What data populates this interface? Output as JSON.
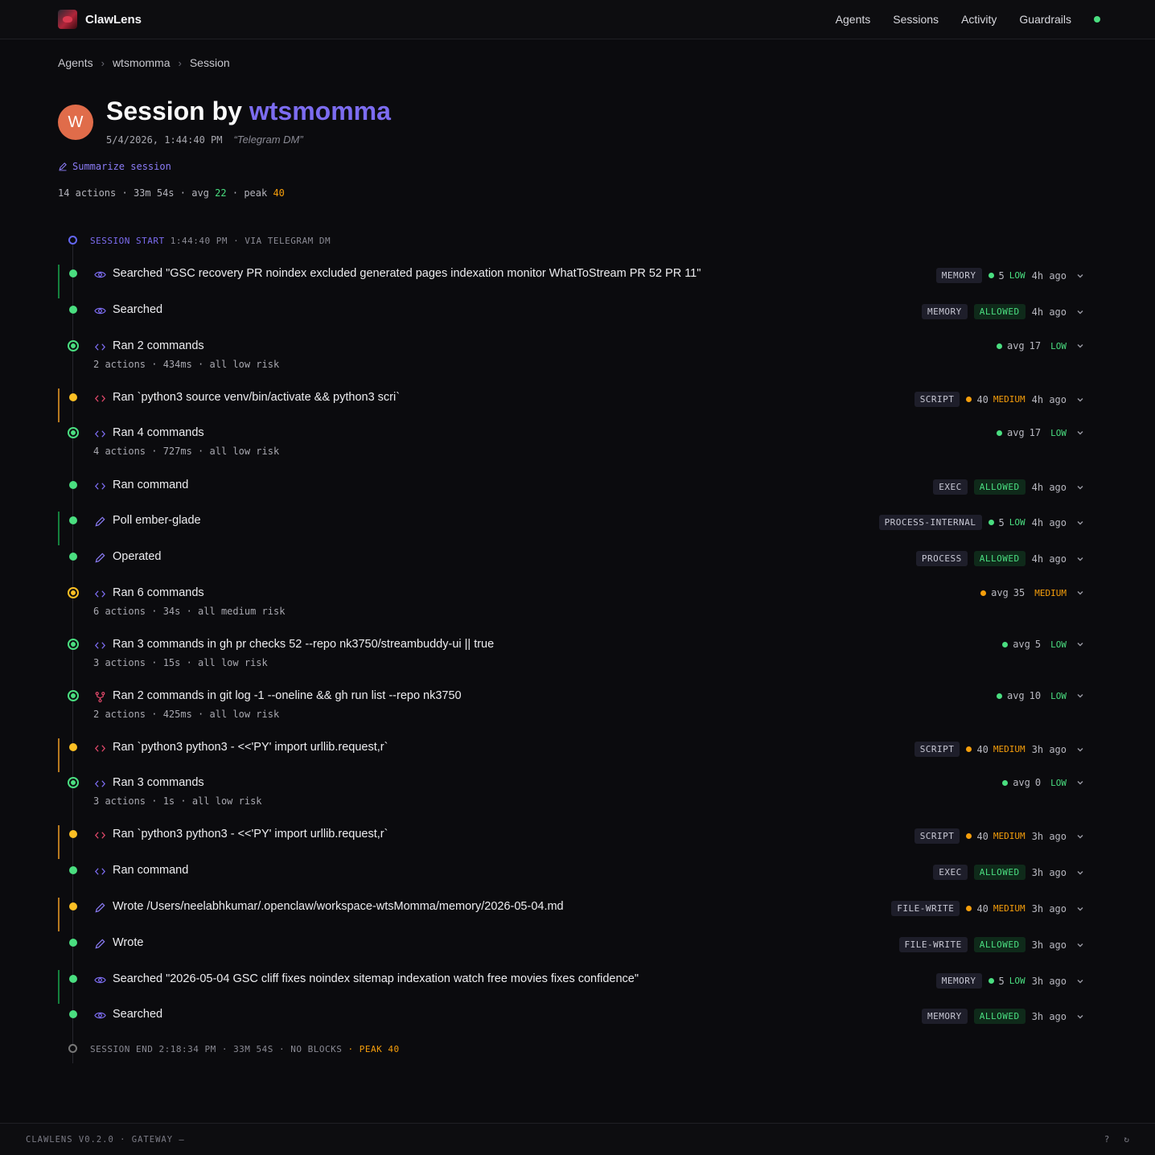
{
  "app": {
    "name": "ClawLens"
  },
  "nav": {
    "agents": "Agents",
    "sessions": "Sessions",
    "activity": "Activity",
    "guardrails": "Guardrails"
  },
  "breadcrumb": [
    "Agents",
    "wtsmomma",
    "Session"
  ],
  "header": {
    "avatar_letter": "W",
    "title_prefix": "Session by",
    "username": "wtsmomma",
    "timestamp": "5/4/2026, 1:44:40 PM",
    "channel_quote": "“Telegram DM”",
    "summarize_label": "Summarize session"
  },
  "stats": {
    "actions": "14 actions",
    "duration": "33m 54s",
    "avg_label": "avg",
    "avg": "22",
    "peak_label": "peak",
    "peak": "40",
    "sep": "·"
  },
  "timeline": {
    "start": {
      "label": "SESSION START",
      "rest": "1:44:40 PM · VIA TELEGRAM DM"
    },
    "end": {
      "label": "SESSION END 2:18:34 PM · 33M 54S · NO BLOCKS",
      "peak": "· PEAK 40"
    },
    "rows": [
      {
        "title": "Searched \"GSC recovery PR noindex excluded generated pages indexation monitor WhatToStream PR 52 PR 11\"",
        "tag": "MEMORY",
        "score": "5",
        "level": "LOW",
        "ago": "4h ago"
      },
      {
        "title": "Searched",
        "tag": "MEMORY",
        "status": "ALLOWED",
        "ago": "4h ago"
      },
      {
        "title": "Ran 2 commands",
        "sub": "2 actions · 434ms · all low risk",
        "avg_label": "avg",
        "avg": "17",
        "level": "LOW"
      },
      {
        "title": "Ran `python3 source venv/bin/activate && python3 scri`",
        "tag": "SCRIPT",
        "score": "40",
        "level": "MEDIUM",
        "ago": "4h ago"
      },
      {
        "title": "Ran 4 commands",
        "sub": "4 actions · 727ms · all low risk",
        "avg_label": "avg",
        "avg": "17",
        "level": "LOW"
      },
      {
        "title": "Ran command",
        "tag": "EXEC",
        "status": "ALLOWED",
        "ago": "4h ago"
      },
      {
        "title": "Poll ember-glade",
        "tag": "PROCESS-INTERNAL",
        "score": "5",
        "level": "LOW",
        "ago": "4h ago"
      },
      {
        "title": "Operated",
        "tag": "PROCESS",
        "status": "ALLOWED",
        "ago": "4h ago"
      },
      {
        "title": "Ran 6 commands",
        "sub": "6 actions · 34s · all medium risk",
        "avg_label": "avg",
        "avg": "35",
        "level": "MEDIUM"
      },
      {
        "title": "Ran 3 commands in gh pr checks 52 --repo nk3750/streambuddy-ui || true",
        "sub": "3 actions · 15s · all low risk",
        "avg_label": "avg",
        "avg": "5",
        "level": "LOW"
      },
      {
        "title": "Ran 2 commands in git log -1 --oneline && gh run list --repo nk3750",
        "sub": "2 actions · 425ms · all low risk",
        "avg_label": "avg",
        "avg": "10",
        "level": "LOW"
      },
      {
        "title": "Ran `python3 python3 - <<'PY' import urllib.request,r`",
        "tag": "SCRIPT",
        "score": "40",
        "level": "MEDIUM",
        "ago": "3h ago"
      },
      {
        "title": "Ran 3 commands",
        "sub": "3 actions · 1s · all low risk",
        "avg_label": "avg",
        "avg": "0",
        "level": "LOW"
      },
      {
        "title": "Ran `python3 python3 - <<'PY' import urllib.request,r`",
        "tag": "SCRIPT",
        "score": "40",
        "level": "MEDIUM",
        "ago": "3h ago"
      },
      {
        "title": "Ran command",
        "tag": "EXEC",
        "status": "ALLOWED",
        "ago": "3h ago"
      },
      {
        "title": "Wrote /Users/neelabhkumar/.openclaw/workspace-wtsMomma/memory/2026-05-04.md",
        "tag": "FILE-WRITE",
        "score": "40",
        "level": "MEDIUM",
        "ago": "3h ago"
      },
      {
        "title": "Wrote",
        "tag": "FILE-WRITE",
        "status": "ALLOWED",
        "ago": "3h ago"
      },
      {
        "title": "Searched \"2026-05-04 GSC cliff fixes noindex sitemap indexation watch free movies fixes confidence\"",
        "tag": "MEMORY",
        "score": "5",
        "level": "LOW",
        "ago": "3h ago"
      },
      {
        "title": "Searched",
        "tag": "MEMORY",
        "status": "ALLOWED",
        "ago": "3h ago"
      }
    ]
  },
  "footer": {
    "text": "CLAWLENS V0.2.0 · GATEWAY —",
    "help": "?",
    "refresh": "↻"
  },
  "colors": {
    "accent": "#7c6cf0",
    "low": "#4ade80",
    "medium": "#f59e0b",
    "avatar": "#e06c4a"
  }
}
